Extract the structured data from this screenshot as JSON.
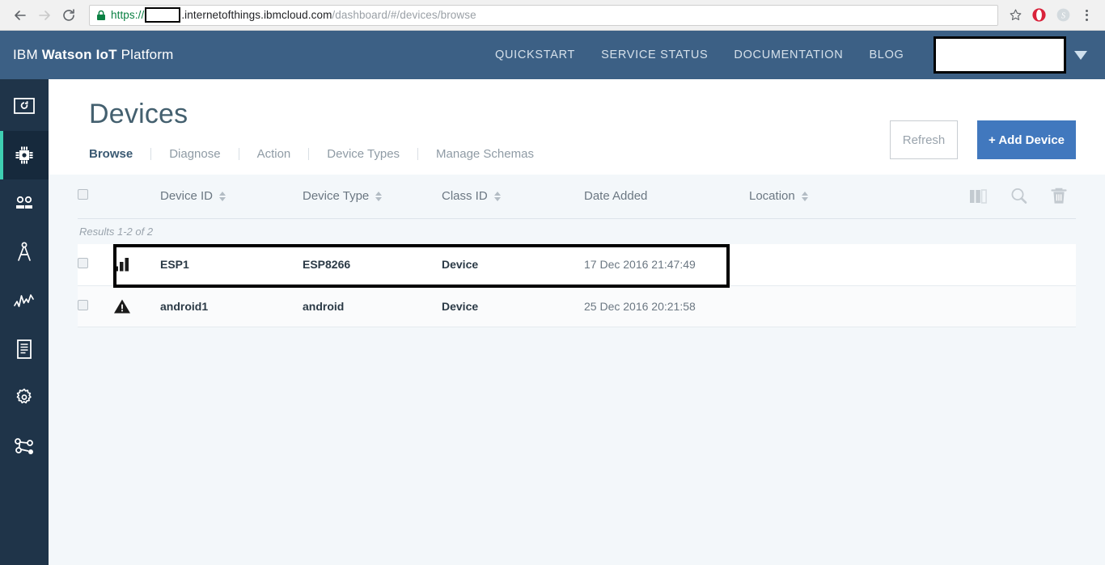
{
  "browser": {
    "back_icon": "back-arrow-icon",
    "forward_icon": "forward-arrow-icon",
    "reload_icon": "reload-icon",
    "lock_icon": "lock-icon",
    "url_scheme": "https://",
    "url_redacted": "",
    "url_host": ".internetofthings.ibmcloud.com",
    "url_path": "/dashboard/#/devices/browse",
    "star_icon": "star-icon",
    "extension_icons": [
      "opera-extension-icon",
      "skype-icon"
    ],
    "menu_icon": "three-dot-menu-icon"
  },
  "header": {
    "brand_prefix": "IBM ",
    "brand_bold": "Watson IoT",
    "brand_suffix": " Platform",
    "nav": [
      {
        "label": "QUICKSTART"
      },
      {
        "label": "SERVICE STATUS"
      },
      {
        "label": "DOCUMENTATION"
      },
      {
        "label": "BLOG"
      }
    ],
    "account_redacted": "",
    "account_caret_icon": "chevron-down-icon",
    "bg_color": "#3c6085"
  },
  "sidebar": {
    "accent_color": "#3ecfb2",
    "bg_color": "#1f3449",
    "items": [
      {
        "icon": "dashboard-board-icon",
        "active": false
      },
      {
        "icon": "chip-devices-icon",
        "active": true
      },
      {
        "icon": "members-users-icon",
        "active": false
      },
      {
        "icon": "compass-drafting-icon",
        "active": false
      },
      {
        "icon": "analytics-pulse-icon",
        "active": false
      },
      {
        "icon": "document-logs-icon",
        "active": false
      },
      {
        "icon": "gear-settings-icon",
        "active": false
      },
      {
        "icon": "network-share-icon",
        "active": false
      }
    ]
  },
  "page": {
    "title": "Devices",
    "tabs": [
      {
        "label": "Browse",
        "active": true
      },
      {
        "label": "Diagnose",
        "active": false
      },
      {
        "label": "Action",
        "active": false
      },
      {
        "label": "Device Types",
        "active": false
      },
      {
        "label": "Manage Schemas",
        "active": false
      }
    ],
    "refresh_label": "Refresh",
    "add_device_label": "+ Add Device",
    "add_device_color": "#4178be"
  },
  "table": {
    "columns": [
      {
        "label": "Device ID",
        "sortable": true
      },
      {
        "label": "Device Type",
        "sortable": true
      },
      {
        "label": "Class ID",
        "sortable": true
      },
      {
        "label": "Date Added",
        "sortable": false
      },
      {
        "label": "Location",
        "sortable": true
      }
    ],
    "tools": [
      {
        "icon": "columns-icon"
      },
      {
        "icon": "search-icon"
      },
      {
        "icon": "trash-icon"
      }
    ],
    "results_text": "Results 1-2 of 2",
    "rows": [
      {
        "status_icon": "bar-chart-icon",
        "device_id": "ESP1",
        "device_type": "ESP8266",
        "class_id": "Device",
        "date_added": "17 Dec 2016 21:47:49",
        "location": ""
      },
      {
        "status_icon": "warning-triangle-icon",
        "device_id": "android1",
        "device_type": "android",
        "class_id": "Device",
        "date_added": "25 Dec 2016 20:21:58",
        "location": ""
      }
    ]
  }
}
